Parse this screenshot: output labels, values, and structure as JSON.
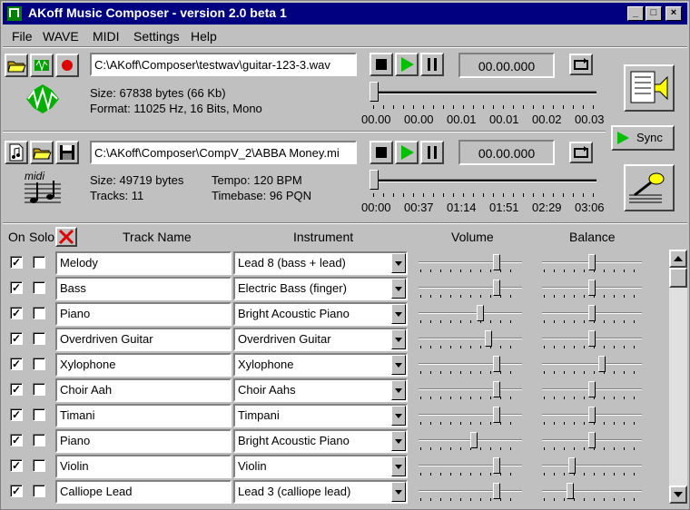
{
  "window": {
    "title": "AKoff Music Composer - version 2.0 beta 1"
  },
  "menu": [
    "File",
    "WAVE",
    "MIDI",
    "Settings",
    "Help"
  ],
  "wave": {
    "path": "C:\\AKoff\\Composer\\testwav\\guitar-123-3.wav",
    "size": "Size: 67838 bytes (66 Kb)",
    "format": "Format: 11025 Hz, 16 Bits, Mono",
    "time": "00.00.000",
    "position": 0,
    "ticks": [
      "00.00",
      "00.00",
      "00.01",
      "00.01",
      "00.02",
      "00.03"
    ]
  },
  "midi": {
    "path": "C:\\AKoff\\Composer\\CompV_2\\ABBA Money.mi",
    "size": "Size: 49719 bytes",
    "tracks": "Tracks: 11",
    "tempo": "Tempo: 120 BPM",
    "timebase": "Timebase: 96 PQN",
    "time": "00.00.000",
    "position": 0,
    "ticks": [
      "00:00",
      "00:37",
      "01:14",
      "01:51",
      "02:29",
      "03:06"
    ]
  },
  "sync_label": "Sync",
  "midi_label": "midi",
  "header": {
    "on": "On",
    "solo": "Solo",
    "track_name": "Track Name",
    "instrument": "Instrument",
    "volume": "Volume",
    "balance": "Balance"
  },
  "tracks": [
    {
      "on": true,
      "solo": false,
      "name": "Melody",
      "instrument": "Lead 8 (bass + lead)",
      "volume": 0.78,
      "balance": 0.5
    },
    {
      "on": true,
      "solo": false,
      "name": "Bass",
      "instrument": "Electric Bass (finger)",
      "volume": 0.78,
      "balance": 0.5
    },
    {
      "on": true,
      "solo": false,
      "name": "Piano",
      "instrument": "Bright Acoustic Piano",
      "volume": 0.62,
      "balance": 0.5
    },
    {
      "on": true,
      "solo": false,
      "name": "Overdriven Guitar",
      "instrument": "Overdriven Guitar",
      "volume": 0.7,
      "balance": 0.5
    },
    {
      "on": true,
      "solo": false,
      "name": "Xylophone",
      "instrument": "Xylophone",
      "volume": 0.78,
      "balance": 0.6
    },
    {
      "on": true,
      "solo": false,
      "name": "Choir Aah",
      "instrument": "Choir Aahs",
      "volume": 0.78,
      "balance": 0.5
    },
    {
      "on": true,
      "solo": false,
      "name": "Timani",
      "instrument": "Timpani",
      "volume": 0.78,
      "balance": 0.5
    },
    {
      "on": true,
      "solo": false,
      "name": "Piano",
      "instrument": "Bright Acoustic Piano",
      "volume": 0.55,
      "balance": 0.5
    },
    {
      "on": true,
      "solo": false,
      "name": "Violin",
      "instrument": "Violin",
      "volume": 0.78,
      "balance": 0.3
    },
    {
      "on": true,
      "solo": false,
      "name": "Calliope Lead",
      "instrument": "Lead 3 (calliope lead)",
      "volume": 0.78,
      "balance": 0.28
    }
  ]
}
